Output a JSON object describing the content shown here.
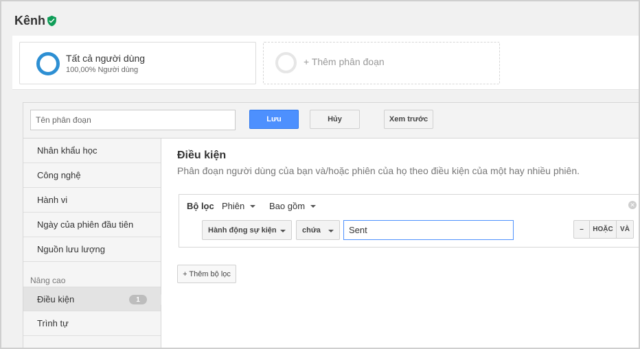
{
  "header": {
    "title": "Kênh",
    "verified_icon": "verified-shield-check-icon"
  },
  "segments": {
    "active": {
      "name": "Tất cả người dùng",
      "sub": "100,00% Người dùng"
    },
    "add_label": "+ Thêm phân đoạn"
  },
  "toolbar": {
    "name_placeholder": "Tên phân đoạn",
    "save_label": "Lưu",
    "cancel_label": "Hủy",
    "preview_label": "Xem trước"
  },
  "nav": {
    "items": [
      {
        "label": "Nhân khẩu học"
      },
      {
        "label": "Công nghệ"
      },
      {
        "label": "Hành vi"
      },
      {
        "label": "Ngày của phiên đầu tiên"
      },
      {
        "label": "Nguồn lưu lượng"
      }
    ],
    "advanced_heading": "Nâng cao",
    "advanced_items": [
      {
        "label": "Điều kiện",
        "badge": "1",
        "active": true
      },
      {
        "label": "Trình tự"
      }
    ]
  },
  "main": {
    "title": "Điều kiện",
    "description": "Phân đoạn người dùng của bạn và/hoặc phiên của họ theo điều kiện của một hay nhiều phiên.",
    "filter": {
      "label": "Bộ lọc",
      "scope": "Phiên",
      "mode": "Bao gồm",
      "dimension": "Hành động sự kiện",
      "operator": "chứa",
      "value": "Sent",
      "minus_label": "–",
      "or_label": "HOẶC",
      "and_label": "VÀ"
    },
    "add_filter_label": "+ Thêm bộ lọc"
  },
  "colors": {
    "accent": "#4d90fe",
    "ring": "#2d8fd3",
    "verified": "#0f9d58"
  }
}
